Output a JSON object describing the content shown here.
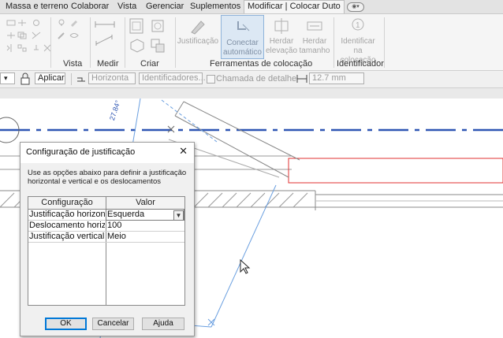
{
  "tabs": [
    "Massa e terreno",
    "Colaborar",
    "Vista",
    "Gerenciar",
    "Suplementos",
    "Modificar | Colocar Duto"
  ],
  "ribbon": {
    "buttons": {
      "justificacao": "Justificação",
      "conectar_1": "Conectar",
      "conectar_2": "automático",
      "herdar_elev_1": "Herdar",
      "herdar_elev_2": "elevação",
      "herdar_tam_1": "Herdar",
      "herdar_tam_2": "tamanho",
      "identificar_1": "Identificar",
      "identificar_2": "na colocação"
    },
    "panels": {
      "vista": "Vista",
      "medir": "Medir",
      "criar": "Criar",
      "ferramentas": "Ferramentas de colocação",
      "identificador": "Identificador"
    }
  },
  "options": {
    "aplicar": "Aplicar",
    "orientation": "Horizonta",
    "tag_field": "Identificadores...",
    "callout_label": "Chamada de detalhe",
    "distance": "12.7 mm"
  },
  "canvas": {
    "dim_text": "27.84°"
  },
  "dialog": {
    "title": "Configuração de justificação",
    "close": "✕",
    "description": "Use as opções abaixo para definir a justificação horizontal e vertical e os deslocamentos",
    "headers": {
      "config": "Configuração",
      "value": "Valor"
    },
    "rows": [
      {
        "name": "Justificação horizontal",
        "value": "Esquerda"
      },
      {
        "name": "Deslocamento horizon",
        "value": "100"
      },
      {
        "name": "Justificação vertical",
        "value": "Meio"
      }
    ],
    "buttons": {
      "ok": "OK",
      "cancel": "Cancelar",
      "help": "Ajuda"
    }
  }
}
